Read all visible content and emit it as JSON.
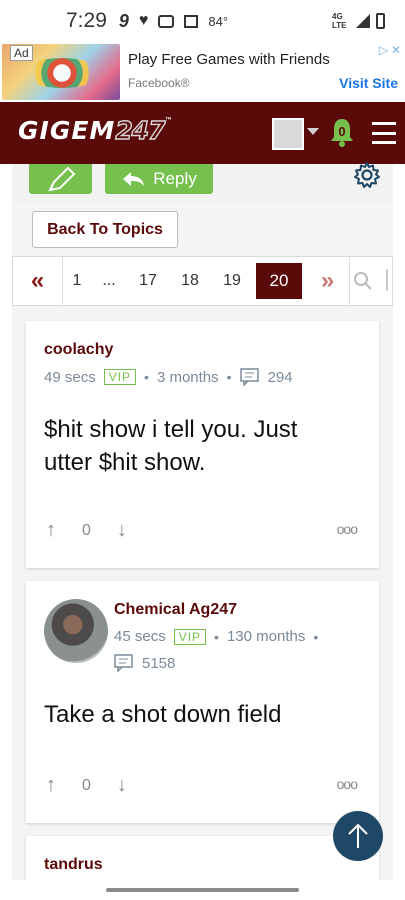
{
  "status_bar": {
    "time": "7:29",
    "temperature": "84°",
    "network": "4G LTE"
  },
  "ad": {
    "tag": "Ad",
    "title": "Play Free Games with Friends",
    "source": "Facebook®",
    "cta": "Visit Site"
  },
  "header": {
    "logo_text": "GIGEM",
    "logo_num": "247",
    "logo_tm": "™",
    "notification_count": "0"
  },
  "toolbar": {
    "reply_label": "Reply"
  },
  "back_label": "Back To Topics",
  "pagination": {
    "prev": "«",
    "first": "1",
    "ellipsis": "...",
    "pages": [
      "17",
      "18",
      "19"
    ],
    "current": "20",
    "next": "»"
  },
  "posts": [
    {
      "username": "coolachy",
      "time": "49 secs",
      "badge": "VIP",
      "tenure": "3 months",
      "post_count": "294",
      "body_line1": "$hit show i tell you. Just",
      "body_line2": "utter $hit show.",
      "votes": "0"
    },
    {
      "username": "Chemical Ag247",
      "time": "45 secs",
      "badge": "VIP",
      "tenure": "130 months",
      "post_count": "5158",
      "body_line1": "Take a shot down field",
      "votes": "0"
    },
    {
      "username": "tandrus"
    }
  ],
  "colors": {
    "brand": "#5b0a0a",
    "green": "#76c04e",
    "scroll_button": "#1f4866",
    "vip": "#76c04e"
  }
}
